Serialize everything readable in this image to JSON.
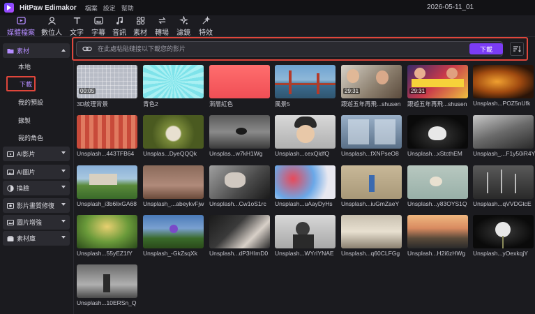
{
  "app": {
    "name": "HitPaw Edimakor",
    "menus": [
      "檔案",
      "設定",
      "幫助"
    ],
    "project_title": "2026-05-11_01"
  },
  "toolbar": {
    "tabs": [
      {
        "label": "媒體檔案",
        "icon": "media-icon",
        "active": true
      },
      {
        "label": "數位人",
        "icon": "avatar-icon",
        "active": false
      },
      {
        "label": "文字",
        "icon": "text-icon",
        "active": false
      },
      {
        "label": "字幕",
        "icon": "subtitle-icon",
        "active": false
      },
      {
        "label": "音訊",
        "icon": "music-icon",
        "active": false
      },
      {
        "label": "素材",
        "icon": "elements-icon",
        "active": false
      },
      {
        "label": "轉場",
        "icon": "transition-icon",
        "active": false
      },
      {
        "label": "濾鏡",
        "icon": "filter-icon",
        "active": false
      },
      {
        "label": "特效",
        "icon": "effects-icon",
        "active": false
      }
    ]
  },
  "sidebar": {
    "categories": [
      {
        "label": "素材",
        "icon": "folder-icon",
        "expanded": true
      },
      {
        "label": "AI影片",
        "icon": "ai-video-icon",
        "expanded": false
      },
      {
        "label": "AI圖片",
        "icon": "ai-image-icon",
        "expanded": false
      },
      {
        "label": "換臉",
        "icon": "face-swap-icon",
        "expanded": false
      },
      {
        "label": "影片畫質修復",
        "icon": "enhance-icon",
        "expanded": false
      },
      {
        "label": "圖片增強",
        "icon": "image-enhance-icon",
        "expanded": false
      },
      {
        "label": "素材庫",
        "icon": "library-icon",
        "expanded": false
      }
    ],
    "subitems": [
      "本地",
      "下載",
      "我的預設",
      "錄製",
      "我的角色"
    ],
    "selected": "下載"
  },
  "url_bar": {
    "placeholder": "在此處粘貼鏈接以下載您的影片",
    "value": "",
    "download_label": "下載"
  },
  "media": [
    {
      "caption": "3D紋理背景",
      "duration": "00:05"
    },
    {
      "caption": "青色2",
      "duration": ""
    },
    {
      "caption": "漸層紅色",
      "duration": ""
    },
    {
      "caption": "風景5",
      "duration": ""
    },
    {
      "caption": "跟遊五年再飛...shusen",
      "duration": "29:31"
    },
    {
      "caption": "跟遊五年再飛...shusen",
      "duration": "29:31"
    },
    {
      "caption": "Unsplash...POZ5nUfk",
      "duration": ""
    },
    {
      "caption": "Unsplash...443TFB64",
      "duration": ""
    },
    {
      "caption": "Unsplas...DyeQQQk",
      "duration": ""
    },
    {
      "caption": "Unsplas...w7kH1Wg",
      "duration": ""
    },
    {
      "caption": "Unsplash...cexQldfQ",
      "duration": ""
    },
    {
      "caption": "Unsplash...fXNPseO8",
      "duration": ""
    },
    {
      "caption": "Unsplash...xStcthEM",
      "duration": ""
    },
    {
      "caption": "Unsplash_...F1y50iR4Y",
      "duration": ""
    },
    {
      "caption": "Unsplash_i3b6lixGA68",
      "duration": ""
    },
    {
      "caption": "Unsplash_...abeykvFjw",
      "duration": ""
    },
    {
      "caption": "Unsplash...Cw1oS1rc",
      "duration": ""
    },
    {
      "caption": "Unsplash...uAayDyHs",
      "duration": ""
    },
    {
      "caption": "Unsplash...iuGmZaeY",
      "duration": ""
    },
    {
      "caption": "Unsplash...y83OYS1Q",
      "duration": ""
    },
    {
      "caption": "Unsplash...qVVDGtcE",
      "duration": ""
    },
    {
      "caption": "Unsplash...55yEZ1fY",
      "duration": ""
    },
    {
      "caption": "Unsplash_-GkZsqXk",
      "duration": ""
    },
    {
      "caption": "Unsplash...dP3HImD0",
      "duration": ""
    },
    {
      "caption": "Unsplash...WYrIYNAE",
      "duration": ""
    },
    {
      "caption": "Unsplash...q60CLFGg",
      "duration": ""
    },
    {
      "caption": "Unsplash...H2i6zHWg",
      "duration": ""
    },
    {
      "caption": "Unsplash...yOexkqjY",
      "duration": ""
    },
    {
      "caption": "Unsplash...10ERSn_Q",
      "duration": ""
    }
  ]
}
